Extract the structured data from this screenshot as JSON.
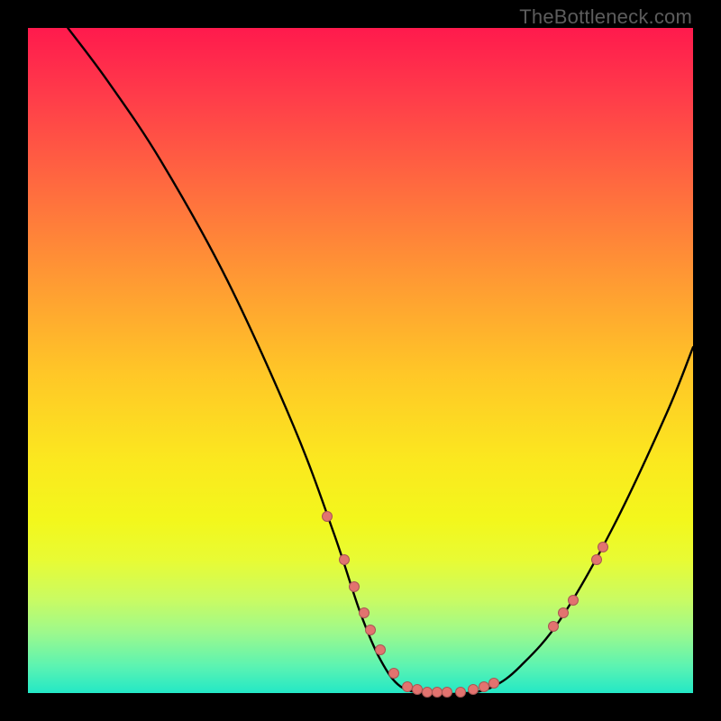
{
  "watermark": "TheBottleneck.com",
  "chart_data": {
    "type": "line",
    "title": "",
    "xlabel": "",
    "ylabel": "",
    "xlim": [
      0,
      100
    ],
    "ylim": [
      0,
      100
    ],
    "grid": false,
    "series": [
      {
        "name": "curve",
        "description": "Black bottleneck curve; higher y = greater bottleneck",
        "points": [
          {
            "x": 6,
            "y": 100
          },
          {
            "x": 12,
            "y": 92
          },
          {
            "x": 20,
            "y": 80
          },
          {
            "x": 30,
            "y": 62
          },
          {
            "x": 40,
            "y": 40
          },
          {
            "x": 46,
            "y": 24
          },
          {
            "x": 50,
            "y": 12
          },
          {
            "x": 53,
            "y": 5
          },
          {
            "x": 56,
            "y": 1
          },
          {
            "x": 60,
            "y": 0
          },
          {
            "x": 66,
            "y": 0
          },
          {
            "x": 70,
            "y": 1
          },
          {
            "x": 74,
            "y": 4
          },
          {
            "x": 80,
            "y": 11
          },
          {
            "x": 88,
            "y": 25
          },
          {
            "x": 96,
            "y": 42
          },
          {
            "x": 100,
            "y": 52
          }
        ]
      },
      {
        "name": "markers",
        "description": "Salmon-colored data points along the curve",
        "points": [
          {
            "x": 45.0,
            "y": 26.5
          },
          {
            "x": 47.5,
            "y": 20.0
          },
          {
            "x": 49.0,
            "y": 16.0
          },
          {
            "x": 50.5,
            "y": 12.0
          },
          {
            "x": 51.5,
            "y": 9.5
          },
          {
            "x": 53.0,
            "y": 6.5
          },
          {
            "x": 55.0,
            "y": 3.0
          },
          {
            "x": 57.0,
            "y": 1.0
          },
          {
            "x": 58.5,
            "y": 0.5
          },
          {
            "x": 60.0,
            "y": 0.2
          },
          {
            "x": 61.5,
            "y": 0.2
          },
          {
            "x": 63.0,
            "y": 0.2
          },
          {
            "x": 65.0,
            "y": 0.2
          },
          {
            "x": 67.0,
            "y": 0.5
          },
          {
            "x": 68.5,
            "y": 1.0
          },
          {
            "x": 70.0,
            "y": 1.5
          },
          {
            "x": 79.0,
            "y": 10.0
          },
          {
            "x": 80.5,
            "y": 12.0
          },
          {
            "x": 82.0,
            "y": 14.0
          },
          {
            "x": 85.5,
            "y": 20.0
          },
          {
            "x": 86.5,
            "y": 22.0
          }
        ]
      }
    ],
    "background": {
      "description": "Vertical gradient from red (top, high bottleneck) to green (bottom, no bottleneck)",
      "stops": [
        {
          "pos": 0,
          "color": "#ff1a4d"
        },
        {
          "pos": 50,
          "color": "#ffc727"
        },
        {
          "pos": 100,
          "color": "#23e8c6"
        }
      ]
    }
  }
}
